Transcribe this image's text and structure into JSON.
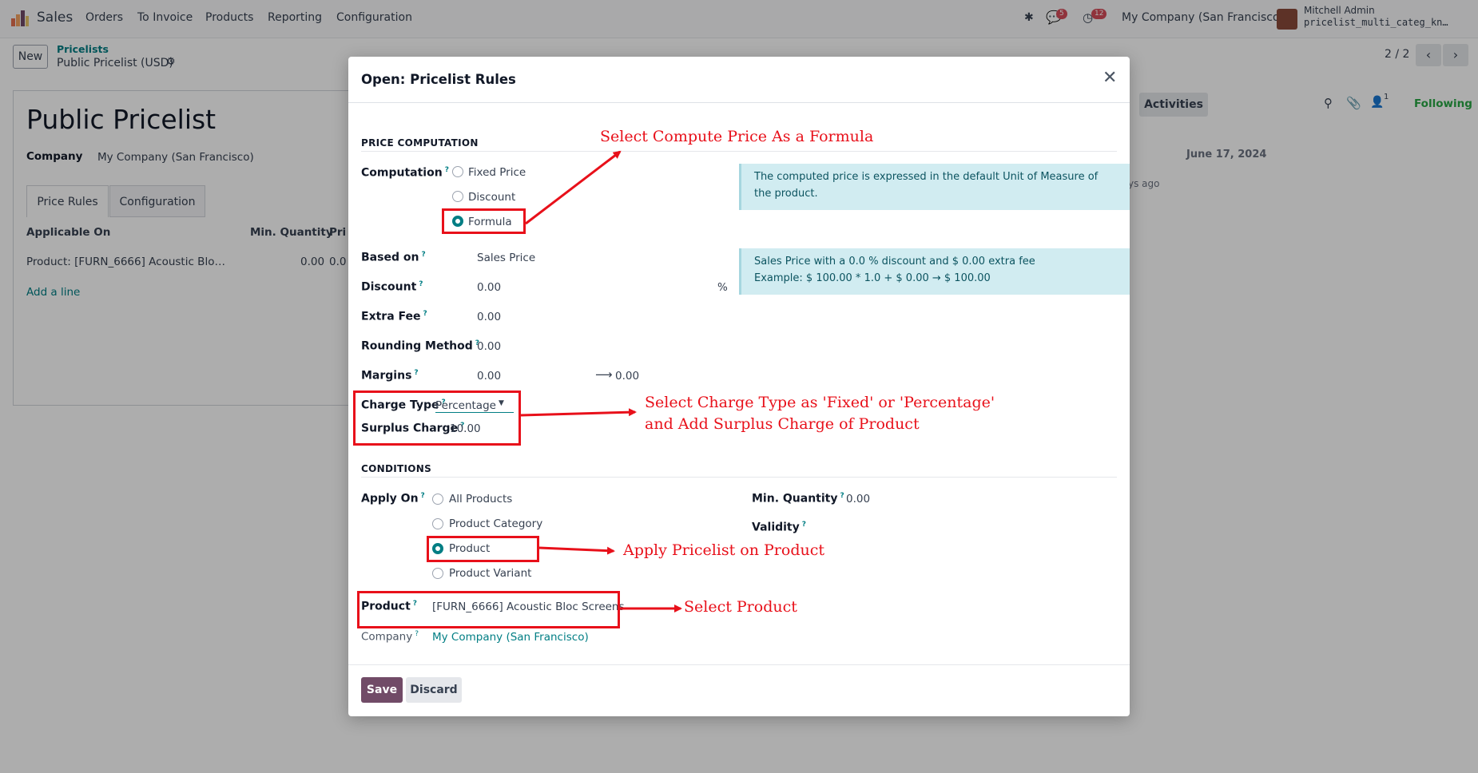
{
  "nav": {
    "app": "Sales",
    "menu": [
      "Orders",
      "To Invoice",
      "Products",
      "Reporting",
      "Configuration"
    ],
    "chat_badge": "5",
    "activity_badge": "12",
    "company": "My Company (San Francisco)",
    "user_name": "Mitchell Admin",
    "db_name": "pricelist_multi_categ_kn…"
  },
  "control": {
    "new_label": "New",
    "breadcrumb_parent": "Pricelists",
    "breadcrumb_current": "Public Pricelist (USD)",
    "pager": "2 / 2"
  },
  "record": {
    "title": "Public Pricelist",
    "company_label": "Company",
    "company_value": "My Company (San Francisco)",
    "tabs": [
      "Price Rules",
      "Configuration"
    ],
    "columns": [
      "Applicable On",
      "Min. Quantity",
      "Pri"
    ],
    "row": {
      "applicable_on": "Product: [FURN_6666] Acoustic Blo…",
      "min_qty": "0.00",
      "price": "0.0"
    },
    "add_line": "Add a line"
  },
  "chatter": {
    "activities": "Activities",
    "followers_count": "1",
    "following": "Following",
    "date": "June 17, 2024",
    "ago": "ys ago"
  },
  "modal": {
    "title": "Open: Pricelist Rules",
    "price_computation": "PRICE COMPUTATION",
    "computation_label": "Computation",
    "computation_options": [
      "Fixed Price",
      "Discount",
      "Formula"
    ],
    "computation_selected": "Formula",
    "alert1": "The computed price is expressed in the default Unit of Measure of the product.",
    "based_on_label": "Based on",
    "based_on_value": "Sales Price",
    "discount_label": "Discount",
    "discount_value": "0.00",
    "percent": "%",
    "alert2_line1": "Sales Price with a 0.0 % discount and $ 0.00 extra fee",
    "alert2_line2": "Example: $ 100.00 * 1.0 + $ 0.00 → $ 100.00",
    "extra_fee_label": "Extra Fee",
    "extra_fee_value": "0.00",
    "rounding_label": "Rounding Method",
    "rounding_value": "0.00",
    "margins_label": "Margins",
    "margin_min": "0.00",
    "margin_max": "0.00",
    "charge_type_label": "Charge Type",
    "charge_type_value": "Percentage",
    "surplus_label": "Surplus Charge",
    "surplus_value": "10.00",
    "conditions": "CONDITIONS",
    "apply_on_label": "Apply On",
    "apply_on_options": [
      "All Products",
      "Product Category",
      "Product",
      "Product Variant"
    ],
    "apply_on_selected": "Product",
    "min_qty_label": "Min. Quantity",
    "min_qty_value": "0.00",
    "validity_label": "Validity",
    "product_label": "Product",
    "product_value": "[FURN_6666] Acoustic Bloc Screens",
    "company_label": "Company",
    "company_value": "My Company (San Francisco)",
    "save": "Save",
    "discard": "Discard"
  },
  "annotations": {
    "formula": "Select Compute Price As a Formula",
    "charge_line1": "Select Charge Type as 'Fixed' or 'Percentage'",
    "charge_line2": "and Add Surplus Charge of Product",
    "apply": "Apply Pricelist on Product",
    "product": "Select Product"
  },
  "colors": {
    "accent": "#017e84",
    "primary_button": "#714b67",
    "annotation": "#e8101a",
    "alert_bg": "#d1ecf1"
  }
}
